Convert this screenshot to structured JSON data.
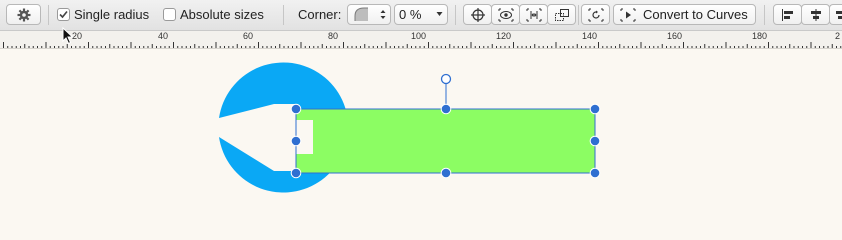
{
  "toolbar": {
    "settings_icon": "gear-icon",
    "single_radius_label": "Single radius",
    "single_radius_checked": true,
    "absolute_sizes_label": "Absolute sizes",
    "absolute_sizes_checked": false,
    "corner_label": "Corner:",
    "corner_value": "0 %",
    "convert_label": "Convert to Curves"
  },
  "ruler": {
    "ticks": [
      "20",
      "40",
      "60",
      "80",
      "100",
      "120",
      "140",
      "160",
      "180",
      "2"
    ]
  },
  "canvas": {
    "shape_colors": {
      "wrench": "#0aa8f5",
      "rectangle": "#8cfd63",
      "selection": "#2f6fd1"
    }
  }
}
